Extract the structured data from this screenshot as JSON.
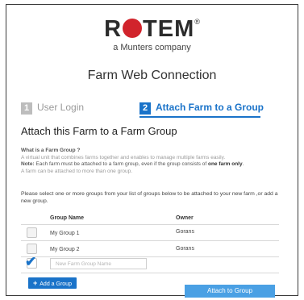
{
  "brand": {
    "name": "ROTEM",
    "registered": "®",
    "tagline": "a Munters company"
  },
  "page_title": "Farm Web Connection",
  "steps": [
    {
      "number": "1",
      "label": "User Login",
      "active": false
    },
    {
      "number": "2",
      "label": "Attach Farm to a Group",
      "active": true
    }
  ],
  "section_title": "Attach this Farm to a Farm Group",
  "info": {
    "question": "What is a Farm Group ?",
    "definition": "A virtual unit that combines farms together and enables to manage multiple farms easily.",
    "note_label": "Note:",
    "note_text": "Each farm must be attached to a farm group, even if the group consists of",
    "note_emphasis": "one farm only",
    "note_tail": "A farm can be attached to more than one group."
  },
  "instructions": "Please select one or more groups from your list of groups below to be attached to your new farm ,or add a new group.",
  "table": {
    "columns": {
      "group": "Group Name",
      "owner": "Owner"
    },
    "rows": [
      {
        "name": "My Group 1",
        "owner": "Gorans",
        "checked": false
      },
      {
        "name": "My Group 2",
        "owner": "Gorans",
        "checked": false
      }
    ],
    "new_group": {
      "placeholder": "New Farm Group Name",
      "value": "",
      "checked": true
    }
  },
  "buttons": {
    "add_group": "Add a Group",
    "attach": "Attach to Group"
  },
  "colors": {
    "accent": "#1a73c9",
    "logo_red": "#d1242c",
    "attach_button": "#4aa0e4"
  }
}
